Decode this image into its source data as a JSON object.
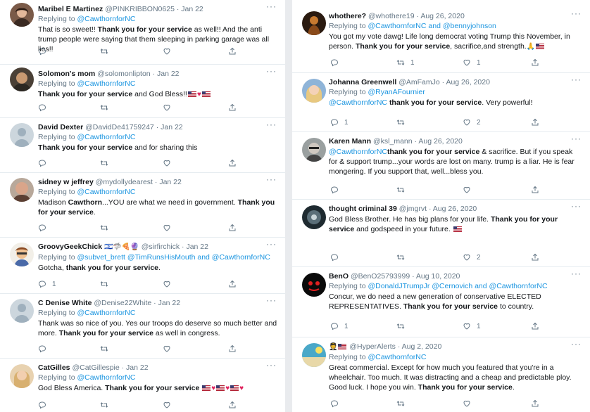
{
  "left": [
    {
      "name": "Maribel E Martinez",
      "handle": "@PINKRIBBON0625",
      "time": "· Jan 22",
      "reply_to": "@CawthornforNC",
      "reply_extra": "",
      "text_before": "That is so sweet!! ",
      "text_bold": "Thank you for your service",
      "text_after": " as well!! And the anti trump people were saying that them sleeping in parking garage was all lies!!",
      "counts": [
        "",
        "",
        "",
        ""
      ]
    },
    {
      "name": "Solomon's mom",
      "handle": "@solomonlipton",
      "time": "· Jan 22",
      "reply_to": "@CawthornforNC",
      "reply_extra": "",
      "text_before": "",
      "text_bold": "Thank you for your service",
      "text_after": " and God Bless!!",
      "counts": [
        "",
        "",
        "",
        ""
      ]
    },
    {
      "name": "David Dexter",
      "handle": "@DavidDe41759247",
      "time": "· Jan 22",
      "reply_to": "@CawthornforNC",
      "reply_extra": "",
      "text_before": "",
      "text_bold": "Thank you for your service",
      "text_after": " and for sharing this",
      "counts": [
        "",
        "",
        "",
        ""
      ]
    },
    {
      "name": "sidney w jeffrey",
      "handle": "@mydollydearest",
      "time": "· Jan 22",
      "reply_to": "@CawthornforNC",
      "reply_extra": "",
      "text_before": "Madison ",
      "text_bold2": "Cawthorn",
      "text_mid": "...YOU are what we need in government.  ",
      "text_bold": "Thank you for your service",
      "text_after": ".",
      "counts": [
        "",
        "",
        "",
        ""
      ]
    },
    {
      "name": "GroovyGeekChick",
      "handle": "@sirfirchick",
      "time": "· Jan 22",
      "reply_to": "@subvet_brett",
      "reply_extra": "@TimRunsHisMouth and @CawthornforNC",
      "text_before": "Gotcha,  ",
      "text_bold": "thank you for your service",
      "text_after": ".",
      "counts": [
        "1",
        "",
        "",
        ""
      ]
    },
    {
      "name": "C Denise White",
      "handle": "@Denise22White",
      "time": "· Jan 22",
      "reply_to": "@CawthornforNC",
      "reply_extra": "",
      "text_before": "Thank was so nice of you. Yes our troops do deserve so much better and more.  ",
      "text_bold": "Thank you for your service",
      "text_after": " as well in congress.",
      "counts": [
        "",
        "",
        "",
        ""
      ]
    },
    {
      "name": "CatGilles",
      "handle": "@CatGillespie",
      "time": "· Jan 22",
      "reply_to": "@CawthornforNC",
      "reply_extra": "",
      "text_before": "God Bless America. ",
      "text_bold": "Thank you for your service",
      "text_after": "",
      "counts": [
        "",
        "",
        "",
        ""
      ]
    }
  ],
  "right": [
    {
      "name": "whothere?",
      "handle": "@whothere19",
      "time": "· Aug 26, 2020",
      "reply_to": "@CawthornforNC and @bennyjohnson",
      "lead": "",
      "text_before": "You got my vote dawg! Life long democrat voting Trump this November, in person. ",
      "text_bold": "Thank you for your service",
      "text_after": ", sacrifice,and strength.",
      "counts": [
        "",
        "1",
        "1",
        ""
      ]
    },
    {
      "name": "Johanna Greenwell",
      "handle": "@AmFamJo",
      "time": "· Aug 26, 2020",
      "reply_to": "@RyanAFournier",
      "lead": "@CawthornforNC",
      "text_before": " ",
      "text_bold": "thank you for your service",
      "text_after": ". Very powerful!",
      "counts": [
        "1",
        "",
        "2",
        ""
      ]
    },
    {
      "name": "Karen Mann",
      "handle": "@ksl_mann",
      "time": "· Aug 26, 2020",
      "reply_to": "",
      "lead": "@CawthornforNC",
      "text_before": " ",
      "text_bold": "thank you for your service",
      "text_after": " & sacrifice.  But if you speak for & support trump...your words are lost on many.  trump is a liar.  He is fear mongering.  If you support that, well...bless you.",
      "counts": [
        "",
        "",
        "",
        ""
      ]
    },
    {
      "name": "thought criminal 39",
      "handle": "@jmgrvt",
      "time": "· Aug 26, 2020",
      "reply_to": "",
      "lead": "",
      "text_before": "God Bless Brother. He has big plans for your life.  ",
      "text_bold": "Thank you for your service",
      "text_after": " and godspeed in your future.",
      "counts": [
        "",
        "",
        "2",
        ""
      ]
    },
    {
      "name": "BenO",
      "handle": "@BenO25793999",
      "time": "· Aug 10, 2020",
      "reply_to": "@DonaldJTrumpJr @Cernovich and @CawthornforNC",
      "lead": "",
      "text_before": "Concur, we do need a new generation of conservative ELECTED REPRESENTATIVES. ",
      "text_bold": "Thank you for your service",
      "text_after": " to country.",
      "counts": [
        "1",
        "",
        "1",
        ""
      ]
    },
    {
      "name": "",
      "handle": "@HyperAlerts",
      "time": "· Aug 2, 2020",
      "reply_to": "@CawthornforNC",
      "lead": "",
      "text_before": "Great commercial. Except for how much you featured that you're in a wheelchair. Too much. It was distracting and a cheap and predictable ploy. Good luck. I hope you win. ",
      "text_bold": "Thank you for your service",
      "text_after": ".",
      "counts": [
        "",
        "",
        "",
        ""
      ]
    }
  ],
  "replying_label": "Replying to",
  "more_label": "···"
}
